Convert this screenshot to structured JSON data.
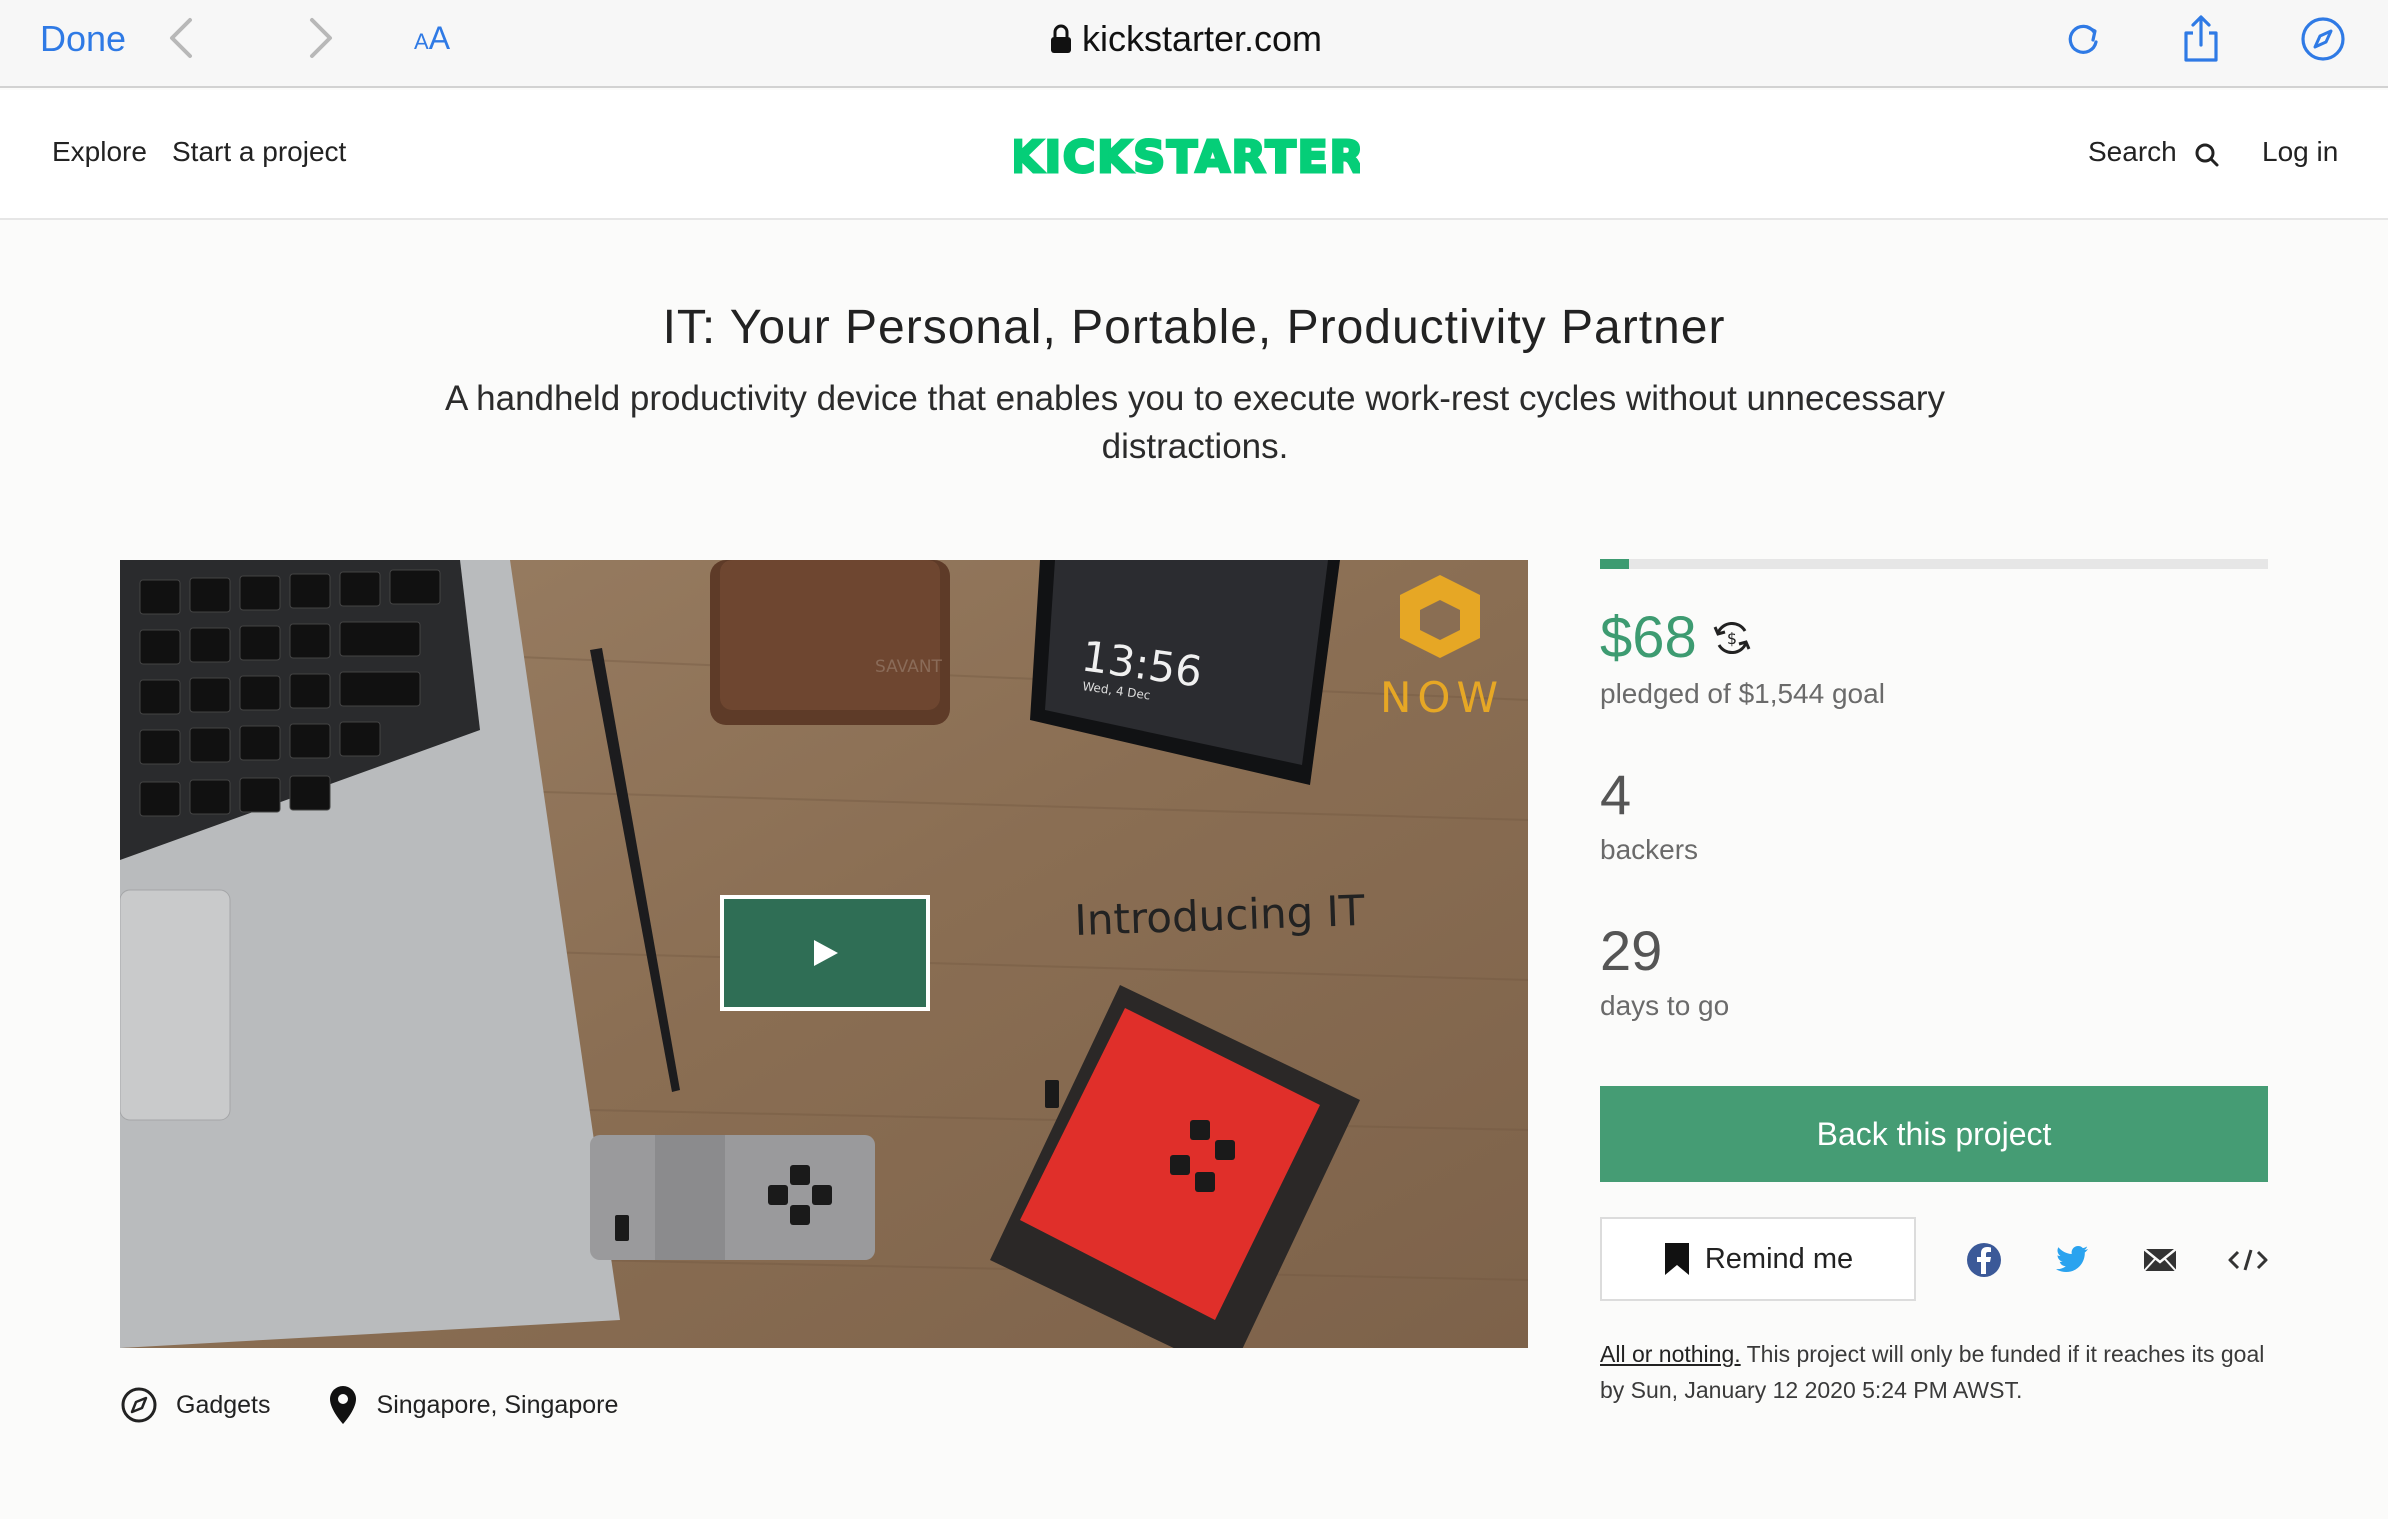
{
  "browser": {
    "done_label": "Done",
    "text_size_label_small": "A",
    "text_size_label_large": "A",
    "url": "kickstarter.com",
    "accent_color": "#2f7ae5"
  },
  "header": {
    "explore": "Explore",
    "start_project": "Start a project",
    "logo_text": "KICKSTARTER",
    "search": "Search",
    "login": "Log in",
    "brand_color": "#05ce78"
  },
  "project": {
    "title": "IT: Your Personal, Portable, Productivity Partner",
    "blurb": "A handheld productivity device that enables you to execute work-rest cycles without unnecessary distractions.",
    "category": "Gadgets",
    "location": "Singapore, Singapore"
  },
  "video": {
    "overlay_text": "Introducing IT",
    "phone_time": "13:56",
    "phone_date": "Wed, 4 Dec",
    "wallet_label": "SAVANT",
    "watermark": "NOW"
  },
  "funding": {
    "progress_percent": 4.4,
    "pledged": "$68",
    "pledged_label": "pledged of $1,544 goal",
    "backers": "4",
    "backers_label": "backers",
    "days": "29",
    "days_label": "days to go",
    "accent_color": "#3d9b71"
  },
  "actions": {
    "back_label": "Back this project",
    "remind_label": "Remind me"
  },
  "fine_print": {
    "link": "All or nothing.",
    "text": " This project will only be funded if it reaches its goal by Sun, January 12 2020 5:24 PM AWST."
  }
}
